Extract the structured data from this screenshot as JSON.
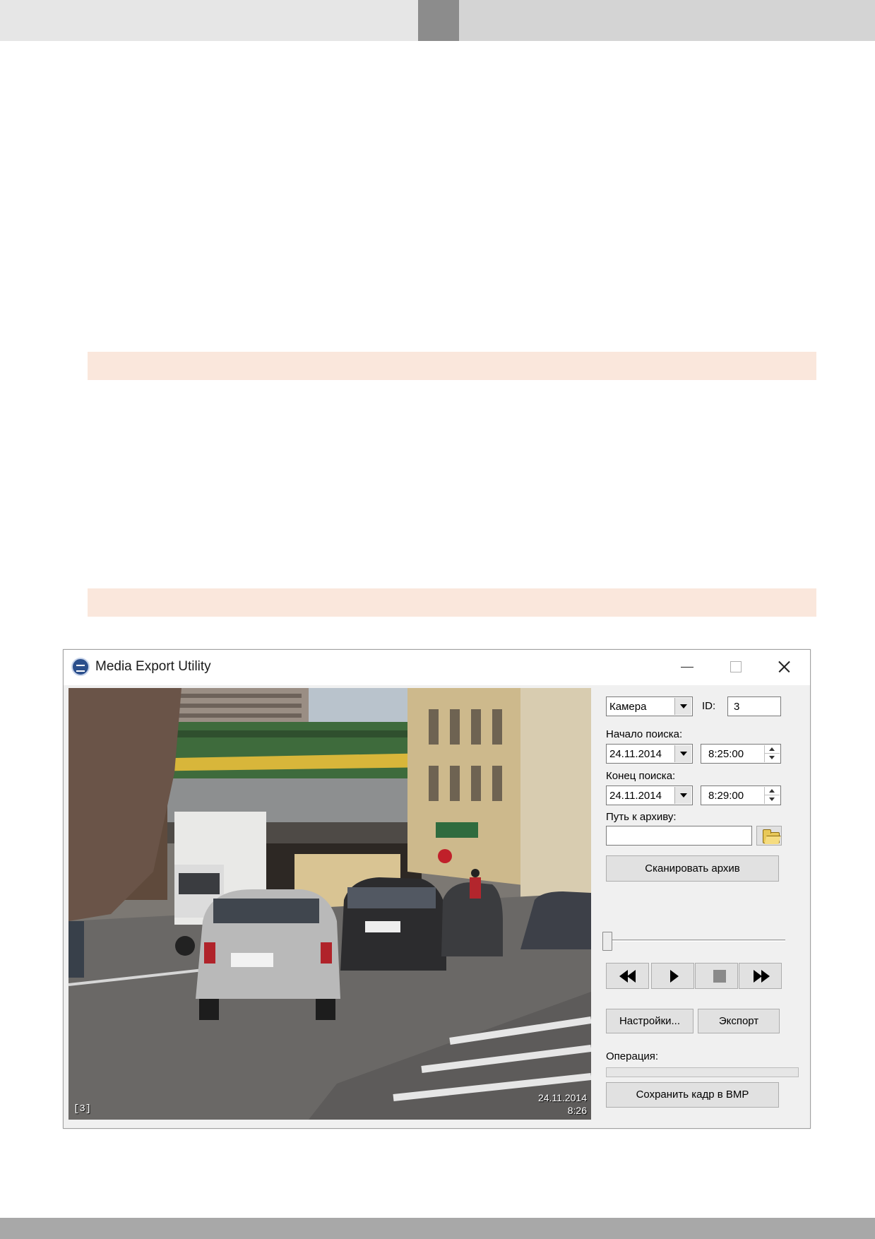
{
  "window": {
    "title": "Media Export Utility"
  },
  "video": {
    "camera_label": "[3]",
    "date": "24.11.2014",
    "time": "8:26"
  },
  "controls": {
    "camera_combo": "Камера",
    "id_label": "ID:",
    "id_value": "3",
    "search_start_label": "Начало поиска:",
    "search_start_date": "24.11.2014",
    "search_start_time": "8:25:00",
    "search_end_label": "Конец поиска:",
    "search_end_date": "24.11.2014",
    "search_end_time": "8:29:00",
    "archive_path_label": "Путь к архиву:",
    "archive_path_value": "",
    "scan_button": "Сканировать архив",
    "settings_button": "Настройки...",
    "export_button": "Экспорт",
    "operation_label": "Операция:",
    "operation_progress": 0,
    "save_frame_button": "Сохранить кадр в BMP",
    "timeline_position": 0
  },
  "icons": {
    "app": "app-logo-icon",
    "browse": "folder-icon",
    "rewind": "rewind-icon",
    "play": "play-icon",
    "stop": "stop-icon",
    "fast_forward": "fast-forward-icon"
  },
  "colors": {
    "highlight_band": "#fae7dc",
    "header_dark": "#8c8c8c",
    "header_light": "#e6e6e6",
    "footer": "#a8a8a8"
  }
}
